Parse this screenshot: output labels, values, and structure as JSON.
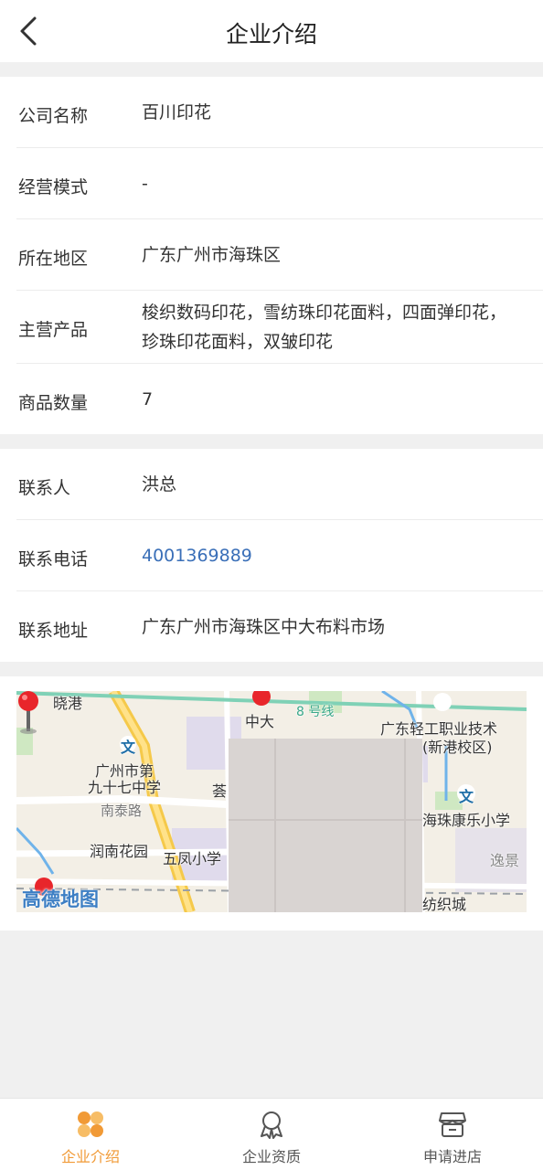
{
  "header": {
    "title": "企业介绍"
  },
  "company": {
    "rows": [
      {
        "label": "公司名称",
        "value": "百川印花"
      },
      {
        "label": "经营模式",
        "value": "-"
      },
      {
        "label": "所在地区",
        "value": "广东广州市海珠区"
      },
      {
        "label": "主营产品",
        "value": "梭织数码印花，雪纺珠印花面料，四面弹印花，珍珠印花面料，双皱印花"
      },
      {
        "label": "商品数量",
        "value": "7"
      }
    ]
  },
  "contact": {
    "rows": [
      {
        "label": "联系人",
        "value": "洪总"
      },
      {
        "label": "联系电话",
        "value": "4001369889"
      },
      {
        "label": "联系地址",
        "value": "广东广州市海珠区中大布料市场"
      }
    ]
  },
  "map": {
    "labels": {
      "xiaogang": "晓港",
      "zhongda": "中大",
      "metro": "8 号线",
      "school1": "广州市第",
      "school1b": "九十七中学",
      "nantai": "南泰路",
      "runnan": "润南花园",
      "wufeng": "五凤小学",
      "yun": "荟",
      "college": "广东轻工职业技术",
      "college2": "(新港校区)",
      "kangle": "海珠康乐小学",
      "yijing": "逸景",
      "fangzhi": "纺织城",
      "wen": "文"
    },
    "logo": "高德地图",
    "pin_color": "#e8262b"
  },
  "tabs": [
    {
      "label": "企业介绍",
      "icon": "company-intro-icon",
      "active": true
    },
    {
      "label": "企业资质",
      "icon": "qualification-icon",
      "active": false
    },
    {
      "label": "申请进店",
      "icon": "store-icon",
      "active": false
    }
  ],
  "colors": {
    "accent": "#f19a36",
    "link": "#3a6fb8"
  }
}
